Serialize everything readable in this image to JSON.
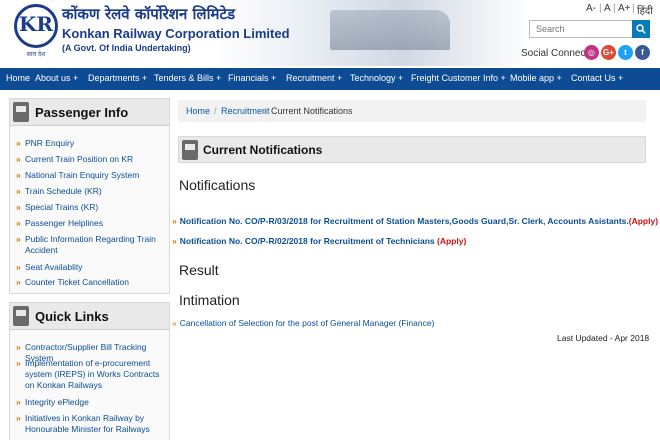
{
  "header": {
    "org_hindi": "कोंकण रेलवे कॉर्पोरेशन लिमिटेड",
    "org_english": "Konkan Railway Corporation Limited",
    "org_tagline": "(A Govt. Of India Undertaking)",
    "logo_letter": "KR",
    "logo_sub": "सारा देश",
    "font_controls": [
      "A-",
      "A",
      "A+",
      "हिंदी"
    ],
    "search_placeholder": "Search",
    "social_label": "Social Connect :",
    "social": [
      "instagram-icon",
      "google-plus-icon",
      "twitter-icon",
      "facebook-icon"
    ],
    "social_glyphs": [
      "◎",
      "G+",
      "t",
      "f"
    ]
  },
  "nav": {
    "items": [
      "Home",
      "About us +",
      "Departments +",
      "Tenders & Bills +",
      "Financials +",
      "Recruitment +",
      "Technology +",
      "Freight Customer Info +",
      "Mobile app +",
      "Contact Us +"
    ]
  },
  "sidebar": {
    "passenger": {
      "title": "Passenger Info",
      "items": [
        "PNR Enquiry",
        "Current Train Position on KR",
        "National Train Enquiry System",
        "Train Schedule (KR)",
        "Special Trains (KR)",
        "Passenger Helplines",
        "Public Information Regarding Train Accident",
        "Seat Availablity",
        "Counter Ticket Cancellation"
      ]
    },
    "quick_links": {
      "title": "Quick Links",
      "items": [
        "Contractor/Supplier Bill Tracking System",
        "Implementation of e-procurement system (IREPS) in Works Contracts on Konkan Railways",
        "Integrity ePledge",
        "Initiatives in Konkan Railway by Honourable Minister for Railways"
      ]
    }
  },
  "breadcrumb": [
    "Home",
    "Recruitment",
    "Current Notifications"
  ],
  "breadcrumb_sep": "/",
  "main": {
    "title": "Current Notifications",
    "notifications_heading": "Notifications",
    "notifications": [
      {
        "text": "Notification No. CO/P-R/03/2018 for Recruitment of Station Masters,Goods Guard,Sr. Clerk, Accounts Asistants.",
        "apply": "(Apply)"
      },
      {
        "text": "Notification No. CO/P-R/02/2018 for Recruitment of Technicians",
        "apply": "(Apply)"
      }
    ],
    "result_heading": "Result",
    "intimation_heading": "Intimation",
    "intimation_item": "Cancellation of Selection for the post of General Manager (Finance)",
    "last_updated": "Last Updated - Apr 2018"
  },
  "bullet": "»",
  "colors": {
    "nav_bg": "#0d4c94",
    "link": "#0a4e94",
    "apply": "#d01010",
    "search_btn": "#0b7ab8"
  }
}
